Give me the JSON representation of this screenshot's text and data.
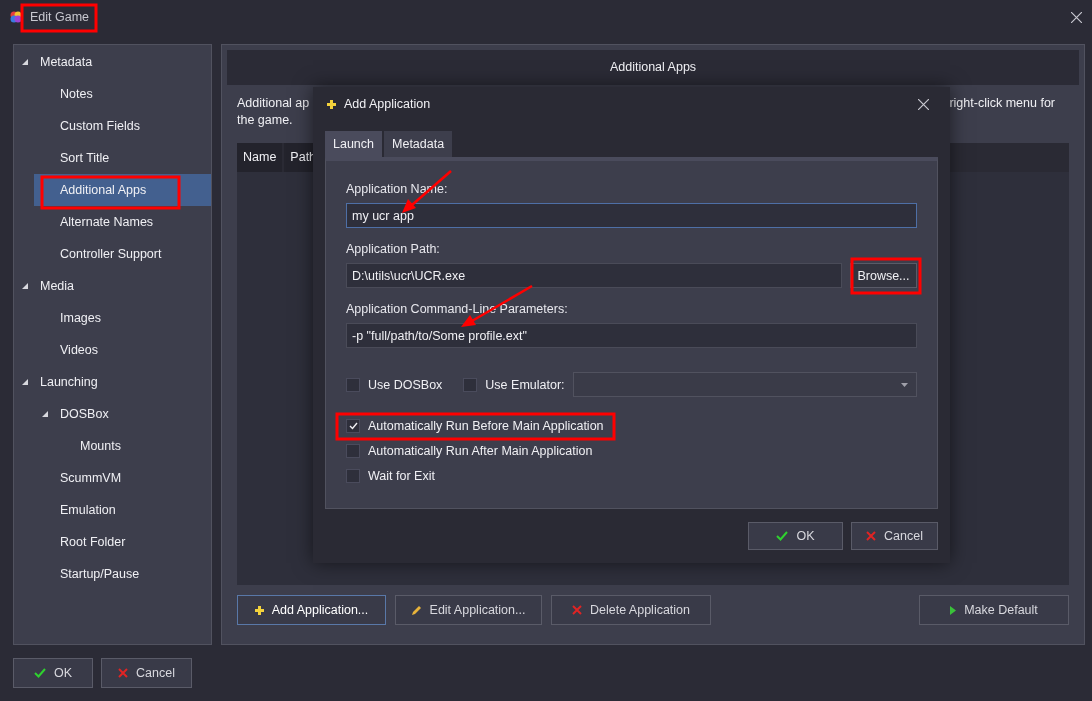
{
  "window": {
    "title": "Edit Game"
  },
  "sidebar": {
    "items": [
      {
        "label": "Metadata",
        "expanded": true,
        "selected": false,
        "children": [
          {
            "label": "Notes",
            "selected": false
          },
          {
            "label": "Custom Fields",
            "selected": false
          },
          {
            "label": "Sort Title",
            "selected": false
          },
          {
            "label": "Additional Apps",
            "selected": true
          },
          {
            "label": "Alternate Names",
            "selected": false
          },
          {
            "label": "Controller Support",
            "selected": false
          }
        ]
      },
      {
        "label": "Media",
        "expanded": true,
        "selected": false,
        "children": [
          {
            "label": "Images",
            "selected": false
          },
          {
            "label": "Videos",
            "selected": false
          }
        ]
      },
      {
        "label": "Launching",
        "expanded": true,
        "selected": false,
        "children": [
          {
            "label": "DOSBox",
            "expanded": true,
            "selected": false,
            "children": [
              {
                "label": "Mounts",
                "selected": false
              }
            ]
          },
          {
            "label": "ScummVM",
            "selected": false
          },
          {
            "label": "Emulation",
            "selected": false
          },
          {
            "label": "Root Folder",
            "selected": false
          },
          {
            "label": "Startup/Pause",
            "selected": false
          }
        ]
      }
    ]
  },
  "main": {
    "header": "Additional Apps",
    "description": {
      "line_1_start": "Additional ap",
      "line_1_end": "right-click menu for",
      "line_2": "the game."
    },
    "table": {
      "columns": [
        "Name",
        "Path"
      ]
    },
    "buttons": [
      {
        "label": "Add Application...",
        "kind": "add",
        "focused": true
      },
      {
        "label": "Edit Application...",
        "kind": "edit",
        "focused": false
      },
      {
        "label": "Delete Application",
        "kind": "delete",
        "focused": false
      },
      {
        "label": "Make Default",
        "kind": "default",
        "focused": false
      }
    ]
  },
  "dialog": {
    "title": "Add Application",
    "tabs": [
      {
        "label": "Launch",
        "selected": true
      },
      {
        "label": "Metadata",
        "selected": false
      }
    ],
    "fields": [
      {
        "label": "Application Name:",
        "value": "my ucr app",
        "focused": true
      },
      {
        "label": "Application Path:",
        "value": "D:\\utils\\ucr\\UCR.exe",
        "focused": false,
        "button": "Browse..."
      },
      {
        "label": "Application Command-Line Parameters:",
        "value": "-p \"full/path/to/Some profile.ext\"",
        "focused": false
      }
    ],
    "use_dosbox": {
      "label": "Use DOSBox",
      "checked": false
    },
    "use_emulator": {
      "label": "Use Emulator:",
      "checked": false
    },
    "options": [
      {
        "label": "Automatically Run Before Main Application",
        "checked": true
      },
      {
        "label": "Automatically Run After Main Application",
        "checked": false
      },
      {
        "label": "Wait for Exit",
        "checked": false
      }
    ],
    "buttons": [
      {
        "label": "OK",
        "kind": "ok"
      },
      {
        "label": "Cancel",
        "kind": "cancel"
      }
    ]
  },
  "footer": {
    "buttons": [
      {
        "label": "OK",
        "kind": "ok"
      },
      {
        "label": "Cancel",
        "kind": "cancel"
      }
    ]
  }
}
